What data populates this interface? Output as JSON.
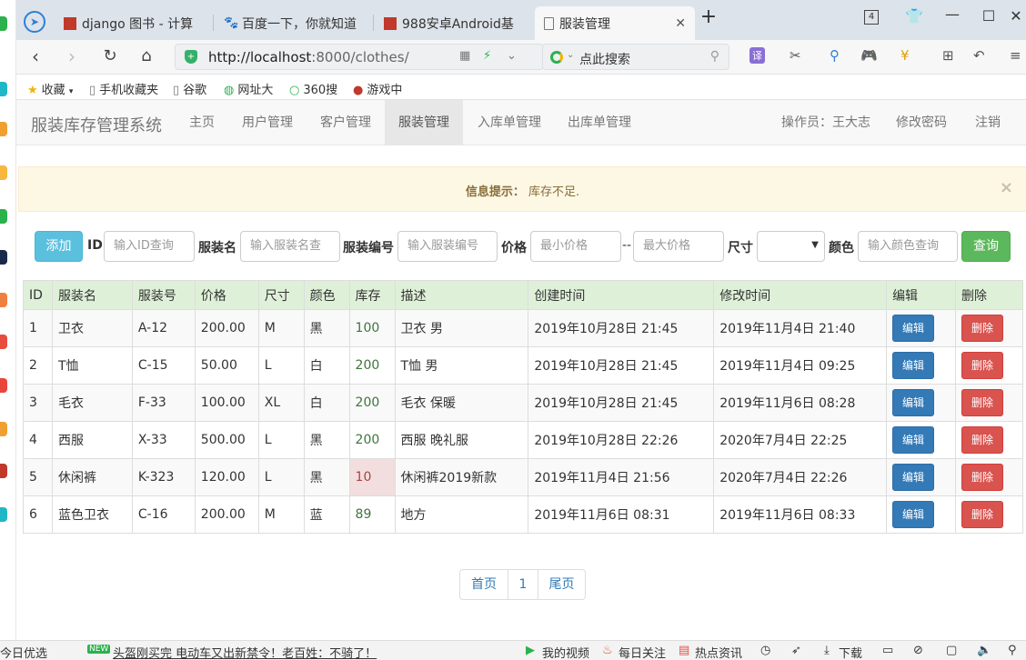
{
  "browser": {
    "tabs": [
      {
        "title": "django 图书 - 计算",
        "favicon": "red-square-icon"
      },
      {
        "title": "百度一下，你就知道",
        "favicon": "baidu-paw-icon"
      },
      {
        "title": "988安卓Android基",
        "favicon": "red-square-icon"
      },
      {
        "title": "服装管理",
        "favicon": "document-icon",
        "active": true
      }
    ],
    "tab_count_badge": "4",
    "url_host": "http://localhost",
    "url_rest": ":8000/clothes/",
    "search_placeholder": "点此搜索",
    "bookmarks": [
      {
        "label": "收藏",
        "icon": "star-icon"
      },
      {
        "label": "手机收藏夹",
        "icon": "document-icon"
      },
      {
        "label": "谷歌",
        "icon": "document-icon"
      },
      {
        "label": "网址大",
        "icon": "globe-icon"
      },
      {
        "label": "360搜",
        "icon": "search-ring-icon"
      },
      {
        "label": "游戏中",
        "icon": "game-icon"
      }
    ],
    "translate_label": "译"
  },
  "app": {
    "brand": "服装库存管理系统",
    "nav": [
      "主页",
      "用户管理",
      "客户管理",
      "服装管理",
      "入库单管理",
      "出库单管理"
    ],
    "active_nav": "服装管理",
    "operator": "操作员：王大志",
    "change_password": "修改密码",
    "logout": "注销"
  },
  "alert": {
    "label": "信息提示：",
    "message": "库存不足.",
    "close": "×"
  },
  "filters": {
    "add_label": "添加",
    "id_label": "ID",
    "id_placeholder": "输入ID查询",
    "name_label": "服装名",
    "name_placeholder": "输入服装名查",
    "code_label": "服装编号",
    "code_placeholder": "输入服装编号",
    "price_label": "价格",
    "min_price_placeholder": "最小价格",
    "sep": "--",
    "max_price_placeholder": "最大价格",
    "size_label": "尺寸",
    "size_value": "",
    "color_label": "颜色",
    "color_placeholder": "输入颜色查询",
    "query_label": "查询"
  },
  "table": {
    "headers": [
      "ID",
      "服装名",
      "服装号",
      "价格",
      "尺寸",
      "颜色",
      "库存",
      "描述",
      "创建时间",
      "修改时间",
      "编辑",
      "删除"
    ],
    "edit_label": "编辑",
    "delete_label": "删除",
    "rows": [
      {
        "id": "1",
        "name": "卫衣",
        "code": "A-12",
        "price": "200.00",
        "size": "M",
        "color": "黑",
        "stock": "100",
        "desc": "卫衣 男",
        "created": "2019年10月28日 21:45",
        "modified": "2019年11月4日 21:40",
        "low": false
      },
      {
        "id": "2",
        "name": "T恤",
        "code": "C-15",
        "price": "50.00",
        "size": "L",
        "color": "白",
        "stock": "200",
        "desc": "T恤 男",
        "created": "2019年10月28日 21:45",
        "modified": "2019年11月4日 09:25",
        "low": false
      },
      {
        "id": "3",
        "name": "毛衣",
        "code": "F-33",
        "price": "100.00",
        "size": "XL",
        "color": "白",
        "stock": "200",
        "desc": "毛衣 保暖",
        "created": "2019年10月28日 21:45",
        "modified": "2019年11月6日 08:28",
        "low": false
      },
      {
        "id": "4",
        "name": "西服",
        "code": "X-33",
        "price": "500.00",
        "size": "L",
        "color": "黑",
        "stock": "200",
        "desc": "西服 晚礼服",
        "created": "2019年10月28日 22:26",
        "modified": "2020年7月4日 22:25",
        "low": false
      },
      {
        "id": "5",
        "name": "休闲裤",
        "code": "K-323",
        "price": "120.00",
        "size": "L",
        "color": "黑",
        "stock": "10",
        "desc": "休闲裤2019新款",
        "created": "2019年11月4日 21:56",
        "modified": "2020年7月4日 22:26",
        "low": true
      },
      {
        "id": "6",
        "name": "蓝色卫衣",
        "code": "C-16",
        "price": "200.00",
        "size": "M",
        "color": "蓝",
        "stock": "89",
        "desc": "地方",
        "created": "2019年11月6日 08:31",
        "modified": "2019年11月6日 08:33",
        "low": false
      }
    ]
  },
  "pagination": {
    "first": "首页",
    "page": "1",
    "last": "尾页"
  },
  "statusbar": {
    "left": "今日优选",
    "new_badge": "NEW",
    "headline": "头盔刚买完 电动车又出新禁令！老百姓：不骑了！",
    "my_video": "我的视频",
    "daily": "每日关注",
    "hot": "热点资讯",
    "download": "下载"
  },
  "colors": {
    "primary": "#337ab7",
    "danger": "#d9534f",
    "success": "#5cb85c",
    "info": "#5bc0de",
    "table_header": "#dff0d8",
    "alert_bg": "#fcf8e3"
  }
}
